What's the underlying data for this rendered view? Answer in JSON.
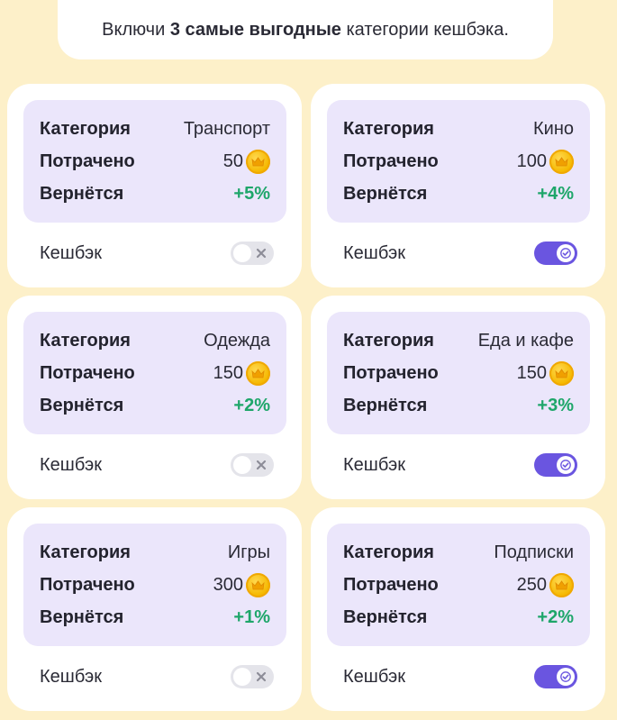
{
  "instruction": {
    "prefix": "Включи ",
    "bold": "3 самые выгодные",
    "suffix": " категории кешбэка."
  },
  "labels": {
    "category": "Категория",
    "spent": "Потрачено",
    "returns": "Вернётся",
    "cashback": "Кешбэк"
  },
  "colors": {
    "background": "#fdf0c9",
    "info_bg": "#ebe6fb",
    "toggle_on": "#6a55e0",
    "toggle_off": "#e4e4ea",
    "percent_green": "#1ea66a",
    "coin": "#f5b800"
  },
  "cards": [
    {
      "category": "Транспорт",
      "spent": "50",
      "returns": "+5%",
      "cashback_on": false
    },
    {
      "category": "Кино",
      "spent": "100",
      "returns": "+4%",
      "cashback_on": true
    },
    {
      "category": "Одежда",
      "spent": "150",
      "returns": "+2%",
      "cashback_on": false
    },
    {
      "category": "Еда и кафе",
      "spent": "150",
      "returns": "+3%",
      "cashback_on": true
    },
    {
      "category": "Игры",
      "spent": "300",
      "returns": "+1%",
      "cashback_on": false
    },
    {
      "category": "Подписки",
      "spent": "250",
      "returns": "+2%",
      "cashback_on": true
    }
  ],
  "icons": {
    "coin": "crown-coin-icon",
    "toggle_on": "check-icon",
    "toggle_off": "x-icon"
  }
}
